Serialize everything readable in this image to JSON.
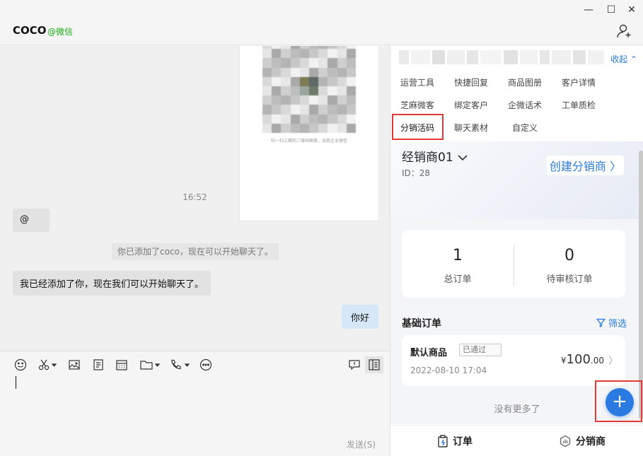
{
  "window": {
    "min": "—",
    "max": "☐",
    "close": "✕"
  },
  "header": {
    "contact_name": "COCO",
    "contact_tag": "@微信"
  },
  "chat": {
    "qr_caption": "扫一扫上面的二维码图案，加我企业微信",
    "time": "16:52",
    "msg_at": "@",
    "system_notice": "你已添加了coco，现在可以开始聊天了。",
    "msg_left": "我已经添加了你，现在我们可以开始聊天了。",
    "msg_right": "你好"
  },
  "input": {
    "send_label": "发送(S)"
  },
  "panel": {
    "collapse": "收起",
    "menu": {
      "ops_tools": "运营工具",
      "quick_reply": "快捷回复",
      "product_album": "商品图册",
      "customer_detail": "客户详情",
      "zhima_customer": "芝麻微客",
      "bind_customer": "绑定客户",
      "wecom_script": "企微话术",
      "ticket_qc": "工单质检",
      "dist_code": "分销活码",
      "chat_material": "聊天素材",
      "custom": "自定义"
    },
    "distributor": {
      "name": "经销商01",
      "id": "ID：28",
      "create": "创建分销商"
    },
    "stats": {
      "total_orders_value": "1",
      "total_orders_label": "总订单",
      "pending_value": "0",
      "pending_label": "待审核订单"
    },
    "orders": {
      "section_title": "基础订单",
      "filter": "筛选",
      "item_title": "默认商品",
      "item_badge": "已通过",
      "item_date": "2022-08-10 17:04",
      "item_currency": "¥",
      "item_price_int": "100",
      "item_price_dec": ".00"
    },
    "no_more": "没有更多了",
    "tabs": {
      "orders": "订单",
      "distributors": "分销商"
    }
  },
  "colors": {
    "accent": "#2a7ae2",
    "highlight": "#e53935",
    "wechat_green": "#1aad19"
  }
}
